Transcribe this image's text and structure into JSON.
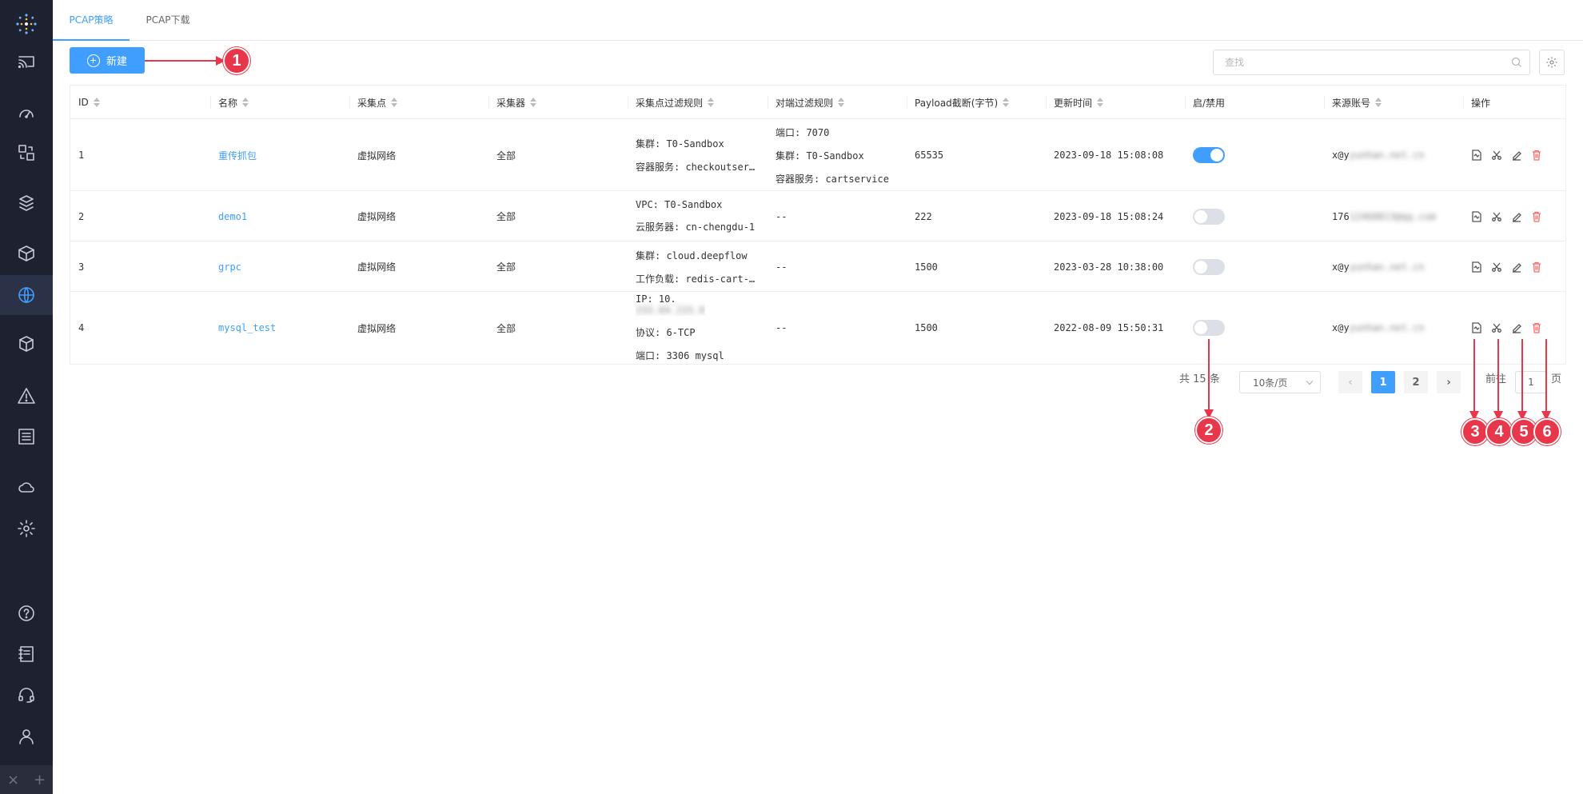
{
  "tabs": [
    {
      "label": "PCAP策略",
      "active": true
    },
    {
      "label": "PCAP下载",
      "active": false
    }
  ],
  "toolbar": {
    "new_label": "新建",
    "search_placeholder": "查找"
  },
  "table": {
    "columns": [
      "ID",
      "名称",
      "采集点",
      "采集器",
      "采集点过滤规则",
      "对端过滤规则",
      "Payload截断(字节)",
      "更新时间",
      "启/禁用",
      "来源账号",
      "操作"
    ],
    "rows": [
      {
        "id": "1",
        "name": "重传抓包",
        "capture_point": "虚拟网络",
        "collector": "全部",
        "capture_filter": [
          "集群: T0-Sandbox",
          "容器服务: checkoutservice"
        ],
        "peer_filter": [
          "端口: 7070",
          "集群: T0-Sandbox",
          "容器服务: cartservice"
        ],
        "payload": "65535",
        "updated": "2023-09-18 15:08:08",
        "enabled": true,
        "account_prefix": "x@y",
        "account_rest": "yunhan.net.cn"
      },
      {
        "id": "2",
        "name": "demo1",
        "capture_point": "虚拟网络",
        "collector": "全部",
        "capture_filter": [
          "VPC: T0-Sandbox",
          "云服务器: cn-chengdu-1"
        ],
        "peer_filter": [
          "--"
        ],
        "payload": "222",
        "updated": "2023-09-18 15:08:24",
        "enabled": false,
        "account_prefix": "176",
        "account_rest": "12468813@qq.com"
      },
      {
        "id": "3",
        "name": "grpc",
        "capture_point": "虚拟网络",
        "collector": "全部",
        "capture_filter": [
          "集群: cloud.deepflow",
          "工作负载: redis-cart-master"
        ],
        "peer_filter": [
          "--"
        ],
        "payload": "1500",
        "updated": "2023-03-28 10:38:00",
        "enabled": false,
        "account_prefix": "x@y",
        "account_rest": "yunhan.net.cn"
      },
      {
        "id": "4",
        "name": "mysql_test",
        "capture_point": "虚拟网络",
        "collector": "全部",
        "capture_filter": [
          "IP: 10.",
          "协议: 6-TCP",
          "端口: 3306 mysql"
        ],
        "capture_filter_blur": "233.69.215.0",
        "peer_filter": [
          "--"
        ],
        "payload": "1500",
        "updated": "2022-08-09 15:50:31",
        "enabled": false,
        "account_prefix": "x@y",
        "account_rest": "yunhan.net.cn"
      }
    ]
  },
  "pagination": {
    "total_prefix": "共",
    "total": "15",
    "total_suffix": "条",
    "page_size": "10条/页",
    "pages": [
      "1",
      "2"
    ],
    "current": "1",
    "goto_label": "前往",
    "goto_value": "1",
    "page_label": "页",
    "prev": "‹",
    "next": "›"
  },
  "annotations": [
    "1",
    "2",
    "3",
    "4",
    "5",
    "6"
  ],
  "colors": {
    "accent": "#409eff",
    "danger": "#f56c6c",
    "annotation": "#e8374a",
    "sidebar": "#1e2230"
  }
}
